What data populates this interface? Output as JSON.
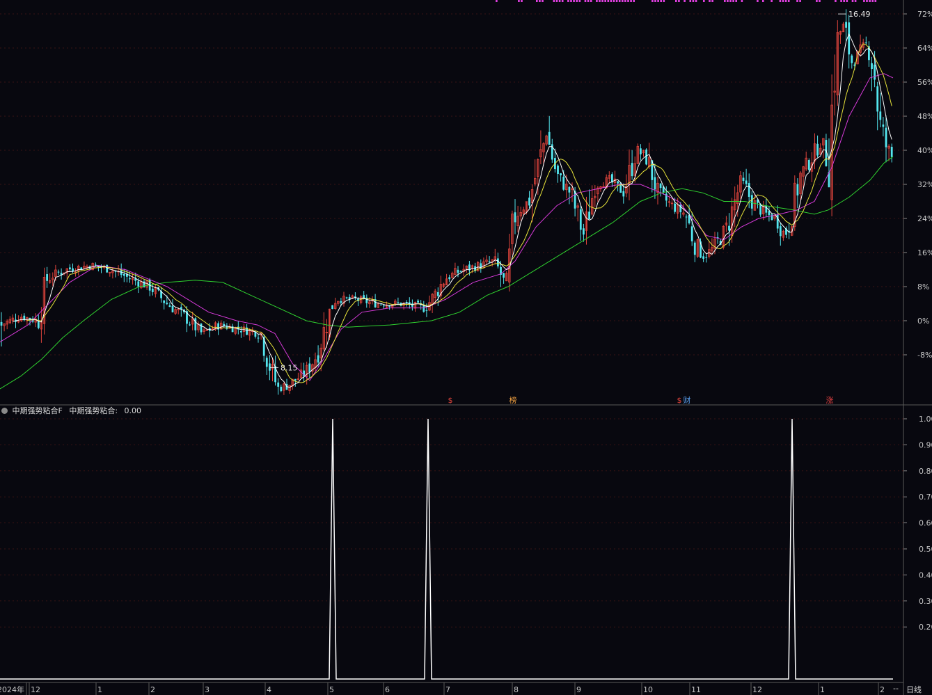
{
  "indicator": {
    "name": "中期强势粘合F",
    "label": "中期强势粘合:",
    "value": "0.00"
  },
  "period_label": "日线",
  "right_edge_marker": "--",
  "colors": {
    "background": "#08080f",
    "up": "#e0443c",
    "down": "#54e6ee",
    "ma_fast": "#ffffff",
    "ma_mid": "#e8e43a",
    "ma_slow": "#d63ad8",
    "ma_long": "#2fd22f",
    "grid": "#3a1414",
    "indicator_line": "#ffffff",
    "top_bars": "#e040e0"
  },
  "chart_data": [
    {
      "type": "candlestick",
      "description_scale": "percent",
      "y_ticks": [
        "72%",
        "64%",
        "56%",
        "48%",
        "40%",
        "32%",
        "24%",
        "16%",
        "8%",
        "0%",
        "-8%"
      ],
      "y_tick_values": [
        72,
        64,
        56,
        48,
        40,
        32,
        24,
        16,
        8,
        0,
        -8
      ],
      "ylim": [
        -14,
        75
      ],
      "annotations": [
        {
          "text": "16.49",
          "x": 1208,
          "y": 71.5
        },
        {
          "text": "8.15",
          "x": 392,
          "y": -11.5
        }
      ],
      "event_markers": [
        {
          "text": "$",
          "x": 647,
          "color": "#e0443c"
        },
        {
          "text": "榜",
          "x": 737,
          "color": "#f0a040"
        },
        {
          "text": "$",
          "x": 976,
          "color": "#e0443c"
        },
        {
          "text": "财",
          "x": 987,
          "color": "#5aa0f0"
        },
        {
          "text": "涨",
          "x": 1192,
          "color": "#e04040"
        }
      ],
      "keypoints": [
        [
          0,
          -1
        ],
        [
          30,
          1
        ],
        [
          55,
          0
        ],
        [
          68,
          10
        ],
        [
          95,
          12
        ],
        [
          130,
          13
        ],
        [
          160,
          12
        ],
        [
          185,
          10
        ],
        [
          215,
          8
        ],
        [
          240,
          4
        ],
        [
          265,
          1
        ],
        [
          290,
          -3
        ],
        [
          315,
          -1
        ],
        [
          345,
          -2
        ],
        [
          375,
          -3
        ],
        [
          390,
          -12
        ],
        [
          400,
          -16
        ],
        [
          415,
          -15
        ],
        [
          440,
          -12
        ],
        [
          455,
          -8
        ],
        [
          468,
          -1
        ],
        [
          480,
          5
        ],
        [
          510,
          5
        ],
        [
          540,
          4
        ],
        [
          575,
          4
        ],
        [
          610,
          3
        ],
        [
          620,
          5
        ],
        [
          640,
          10
        ],
        [
          665,
          12
        ],
        [
          690,
          13
        ],
        [
          710,
          14
        ],
        [
          728,
          8
        ],
        [
          740,
          25
        ],
        [
          760,
          28
        ],
        [
          785,
          44
        ],
        [
          800,
          34
        ],
        [
          820,
          30
        ],
        [
          838,
          20
        ],
        [
          855,
          32
        ],
        [
          875,
          33
        ],
        [
          895,
          30
        ],
        [
          915,
          40
        ],
        [
          930,
          38
        ],
        [
          945,
          30
        ],
        [
          965,
          27
        ],
        [
          985,
          25
        ],
        [
          998,
          18
        ],
        [
          1012,
          15
        ],
        [
          1025,
          17
        ],
        [
          1045,
          22
        ],
        [
          1065,
          33
        ],
        [
          1080,
          28
        ],
        [
          1100,
          25
        ],
        [
          1115,
          24
        ],
        [
          1128,
          20
        ],
        [
          1138,
          26
        ],
        [
          1150,
          34
        ],
        [
          1165,
          38
        ],
        [
          1180,
          42
        ],
        [
          1190,
          35
        ],
        [
          1200,
          62
        ],
        [
          1210,
          70
        ],
        [
          1225,
          60
        ],
        [
          1245,
          65
        ],
        [
          1255,
          60
        ],
        [
          1265,
          45
        ],
        [
          1275,
          40
        ],
        [
          1283,
          38
        ]
      ],
      "moving_averages": {
        "long": [
          [
            0,
            -16
          ],
          [
            30,
            -13
          ],
          [
            60,
            -9
          ],
          [
            90,
            -4
          ],
          [
            120,
            0
          ],
          [
            160,
            5
          ],
          [
            200,
            8
          ],
          [
            240,
            9
          ],
          [
            280,
            9.5
          ],
          [
            320,
            9
          ],
          [
            360,
            6
          ],
          [
            400,
            3
          ],
          [
            440,
            0
          ],
          [
            470,
            -1
          ],
          [
            500,
            -1.5
          ],
          [
            560,
            -1
          ],
          [
            620,
            0
          ],
          [
            660,
            2
          ],
          [
            700,
            6
          ],
          [
            730,
            8
          ],
          [
            760,
            11
          ],
          [
            800,
            15
          ],
          [
            840,
            19
          ],
          [
            880,
            23
          ],
          [
            920,
            28
          ],
          [
            950,
            30
          ],
          [
            980,
            31
          ],
          [
            1010,
            30
          ],
          [
            1040,
            28
          ],
          [
            1070,
            28
          ],
          [
            1100,
            27
          ],
          [
            1140,
            26
          ],
          [
            1170,
            25
          ],
          [
            1190,
            26
          ],
          [
            1220,
            29
          ],
          [
            1250,
            33
          ],
          [
            1270,
            37
          ],
          [
            1283,
            38.5
          ]
        ],
        "mid": [
          [
            0,
            -5
          ],
          [
            40,
            -1
          ],
          [
            70,
            4
          ],
          [
            100,
            9
          ],
          [
            140,
            13
          ],
          [
            180,
            12
          ],
          [
            210,
            10
          ],
          [
            240,
            8
          ],
          [
            270,
            5
          ],
          [
            300,
            2
          ],
          [
            340,
            0
          ],
          [
            370,
            -1
          ],
          [
            395,
            -3
          ],
          [
            420,
            -10
          ],
          [
            445,
            -14
          ],
          [
            465,
            -9
          ],
          [
            490,
            -2
          ],
          [
            520,
            2
          ],
          [
            560,
            3
          ],
          [
            610,
            3
          ],
          [
            640,
            5
          ],
          [
            680,
            9
          ],
          [
            720,
            11
          ],
          [
            740,
            14
          ],
          [
            770,
            22
          ],
          [
            800,
            27
          ],
          [
            830,
            30
          ],
          [
            860,
            31
          ],
          [
            890,
            32
          ],
          [
            920,
            32
          ],
          [
            950,
            30
          ],
          [
            975,
            28
          ],
          [
            995,
            24
          ],
          [
            1015,
            20
          ],
          [
            1040,
            19
          ],
          [
            1065,
            22
          ],
          [
            1090,
            24
          ],
          [
            1120,
            25
          ],
          [
            1145,
            26
          ],
          [
            1170,
            28
          ],
          [
            1195,
            36
          ],
          [
            1220,
            48
          ],
          [
            1250,
            57
          ],
          [
            1270,
            58
          ],
          [
            1283,
            57
          ]
        ]
      }
    },
    {
      "type": "line",
      "name": "中期强势粘合",
      "y_ticks": [
        "1.00",
        "0.90",
        "0.80",
        "0.70",
        "0.60",
        "0.50",
        "0.40",
        "0.30",
        "0.20"
      ],
      "y_tick_values": [
        1.0,
        0.9,
        0.8,
        0.7,
        0.6,
        0.5,
        0.4,
        0.3,
        0.2
      ],
      "ylim": [
        0,
        1.0
      ],
      "baseline": 0,
      "spikes": [
        {
          "x": 478,
          "value": 1.0
        },
        {
          "x": 615,
          "value": 1.0
        },
        {
          "x": 1138,
          "value": 1.0
        }
      ]
    }
  ],
  "x_axis": {
    "labels": [
      "2024年",
      "12",
      "1",
      "2",
      "3",
      "4",
      "5",
      "6",
      "7",
      "8",
      "9",
      "10",
      "11",
      "12",
      "1",
      "2"
    ],
    "positions": [
      0,
      42,
      138,
      214,
      292,
      381,
      471,
      551,
      638,
      736,
      826,
      922,
      991,
      1079,
      1176,
      1262
    ]
  }
}
